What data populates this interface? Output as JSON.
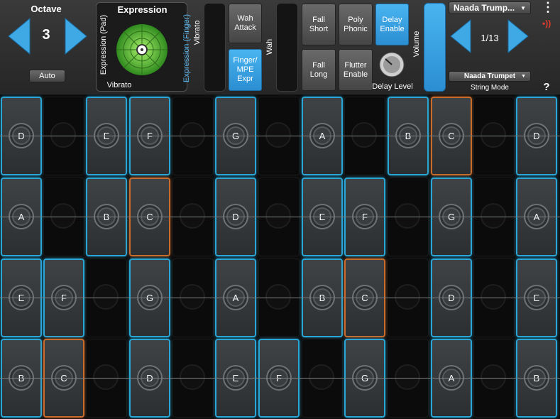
{
  "octave": {
    "title": "Octave",
    "value": "3",
    "auto_label": "Auto"
  },
  "expression": {
    "title": "Expression",
    "pad_label": "Expression (Pad)",
    "finger_label": "Expression (Finger)",
    "vibrato_label": "Vibrato"
  },
  "controls": {
    "vibrato_slot": "Vibrato",
    "wah_slot": "Wah",
    "volume_slot": "Volume",
    "wah_attack": "Wah\nAttack",
    "finger_mpe": "Finger/\nMPE\nExpr",
    "fall_short": "Fall\nShort",
    "poly_phonic": "Poly\nPhonic",
    "delay_enable": "Delay\nEnable",
    "fall_long": "Fall\nLong",
    "flutter_enable": "Flutter\nEnable",
    "delay_level": "Delay Level"
  },
  "preset": {
    "name": "Naada Trump...",
    "index": "1/13",
    "string_select": "Naada Trumpet",
    "string_mode": "String Mode"
  },
  "help": "?",
  "menu_dots": "⋮",
  "colors": {
    "accent": "#2aa6d6",
    "highlight": "#c96b2a",
    "button_blue": "#3ba3e3",
    "pad_green": "#6bd13a"
  },
  "grid": [
    [
      "D",
      "",
      "E",
      "F",
      "",
      "G",
      "",
      "A",
      "",
      "B",
      "C*",
      "",
      "D"
    ],
    [
      "A",
      "",
      "B",
      "C*",
      "",
      "D",
      "",
      "E",
      "F",
      "",
      "G",
      "",
      "A"
    ],
    [
      "E",
      "F",
      "",
      "G",
      "",
      "A",
      "",
      "B",
      "C*",
      "",
      "D",
      "",
      "E"
    ],
    [
      "B",
      "C*",
      "",
      "D",
      "",
      "E",
      "F",
      "",
      "G",
      "",
      "A",
      "",
      "B"
    ]
  ]
}
